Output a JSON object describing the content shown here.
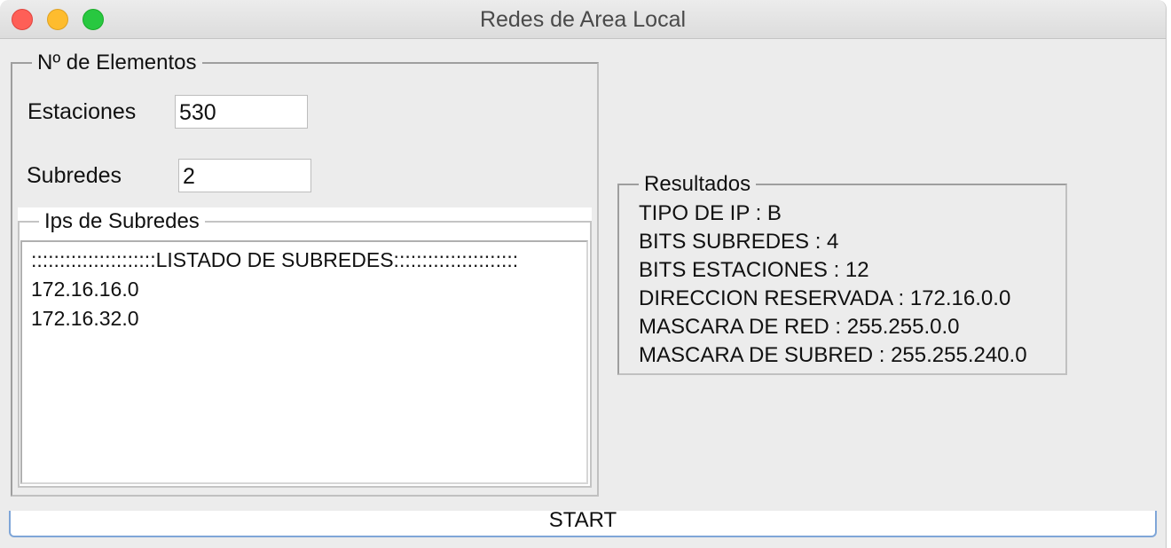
{
  "window": {
    "title": "Redes de Area Local"
  },
  "elementos": {
    "legend": "Nº de Elementos",
    "estaciones_label": "Estaciones",
    "estaciones_value": "530",
    "subredes_label": "Subredes",
    "subredes_value": "2"
  },
  "ips": {
    "legend": "Ips de Subredes",
    "lines": [
      "::::::::::::::::::::::LISTADO DE SUBREDES::::::::::::::::::::::",
      "172.16.16.0",
      "172.16.32.0"
    ]
  },
  "resultados": {
    "legend": "Resultados",
    "lines": [
      "TIPO DE IP : B",
      "BITS SUBREDES : 4",
      "BITS ESTACIONES : 12",
      "DIRECCION RESERVADA : 172.16.0.0",
      "MASCARA DE RED : 255.255.0.0",
      "MASCARA DE SUBRED : 255.255.240.0"
    ]
  },
  "actions": {
    "start_label": "START"
  },
  "colors": {
    "close": "#fe5f57",
    "minimize": "#febc2e",
    "maximize": "#28c840",
    "button_focus": "#7fa6d8"
  }
}
